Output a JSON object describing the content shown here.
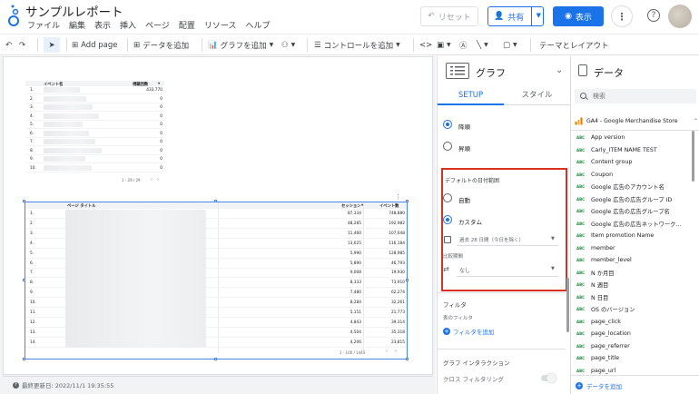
{
  "header": {
    "title": "サンプルレポート",
    "menu": [
      "ファイル",
      "編集",
      "表示",
      "挿入",
      "ページ",
      "配置",
      "リソース",
      "ヘルプ"
    ],
    "reset_label": "リセット",
    "share_label": "共有",
    "view_label": "表示"
  },
  "toolbar": {
    "add_page": "Add page",
    "add_data": "データを追加",
    "add_chart": "グラフを追加",
    "add_control": "コントロールを追加",
    "theme_layout": "テーマとレイアウト"
  },
  "canvas": {
    "table1": {
      "col1": "イベント名",
      "col2": "視聴回数",
      "row_numbers": [
        "1.",
        "2.",
        "3.",
        "4.",
        "5.",
        "6.",
        "7.",
        "8.",
        "9.",
        "10."
      ],
      "values": [
        "433,770",
        "0",
        "0",
        "0",
        "0",
        "0",
        "0",
        "0",
        "0",
        "0"
      ],
      "pagination": "1 - 29 / 29"
    },
    "table2": {
      "col1": "ページ タイトル",
      "col2": "セッション",
      "col3": "イベント数",
      "row_numbers": [
        "1.",
        "2.",
        "3.",
        "4.",
        "5.",
        "6.",
        "7.",
        "8.",
        "9.",
        "10.",
        "11.",
        "12.",
        "13.",
        "14."
      ],
      "sessions": [
        "87,334",
        "48,285",
        "11,460",
        "13,025",
        "5,990",
        "5,890",
        "9,008",
        "8,333",
        "7,480",
        "8,284",
        "5,151",
        "4,843",
        "4,504",
        "4,206"
      ],
      "events": [
        "748,880",
        "192,982",
        "107,048",
        "116,184",
        "128,985",
        "46,793",
        "19,930",
        "73,910",
        "62,274",
        "32,261",
        "21,773",
        "39,314",
        "35,318",
        "23,815"
      ],
      "pagination": "1 - 100 / 1443"
    },
    "last_updated": "最終更新日: 2022/11/1 19:35:55"
  },
  "graph_panel": {
    "title": "グラフ",
    "tabs": [
      "SETUP",
      "スタイル"
    ],
    "sort_desc": "降順",
    "sort_asc": "昇順",
    "default_date_range": "デフォルトの日付範囲",
    "auto": "自動",
    "custom": "カスタム",
    "date_value": "過去 28 日間（今日を除く）",
    "compare_label": "比較期間",
    "compare_value": "なし",
    "filter_heading": "フィルタ",
    "table_filter": "表のフィルタ",
    "add_filter": "フィルタを追加",
    "interaction_heading": "グラフ インタラクション",
    "cross_filter": "クロス フィルタリング"
  },
  "data_panel": {
    "title": "データ",
    "search_placeholder": "検索",
    "source": "GA4 - Google Merchandise Store",
    "field_badge": "ABC",
    "fields": [
      "App version",
      "Carly_ITEM NAME TEST",
      "Content group",
      "Coupon",
      "Google 広告のアカウント名",
      "Google 広告の広告グループ ID",
      "Google 広告の広告グループ名",
      "Google 広告の広告ネットワーク…",
      "Item promotion Name",
      "member",
      "member_level",
      "N か月目",
      "N 週目",
      "N 日目",
      "OS のバージョン",
      "page_click",
      "page_location",
      "page_referrer",
      "page_title",
      "page_url"
    ],
    "add_data": "データを追加"
  },
  "colors": {
    "accent": "#1a73e8",
    "highlight_box": "#d93025",
    "field_badge": "#1e8e3e"
  }
}
